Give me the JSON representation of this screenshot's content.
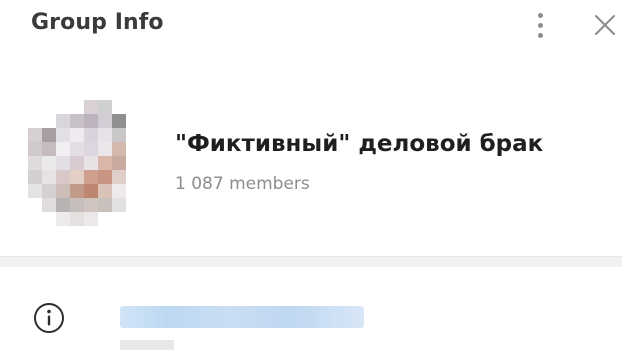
{
  "header": {
    "title": "Group Info",
    "menu_icon": "more-vertical-icon",
    "close_icon": "close-icon"
  },
  "profile": {
    "avatar": "avatar-image",
    "name": "\"Фиктивный\" деловой брак",
    "members": "1 087 members"
  },
  "info": {
    "icon": "info-icon"
  },
  "colors": {
    "title": "#3b3b3b",
    "secondary": "#8c8c8c",
    "divider": "#f1f1f1",
    "link_blur": "#bcd5f0"
  }
}
